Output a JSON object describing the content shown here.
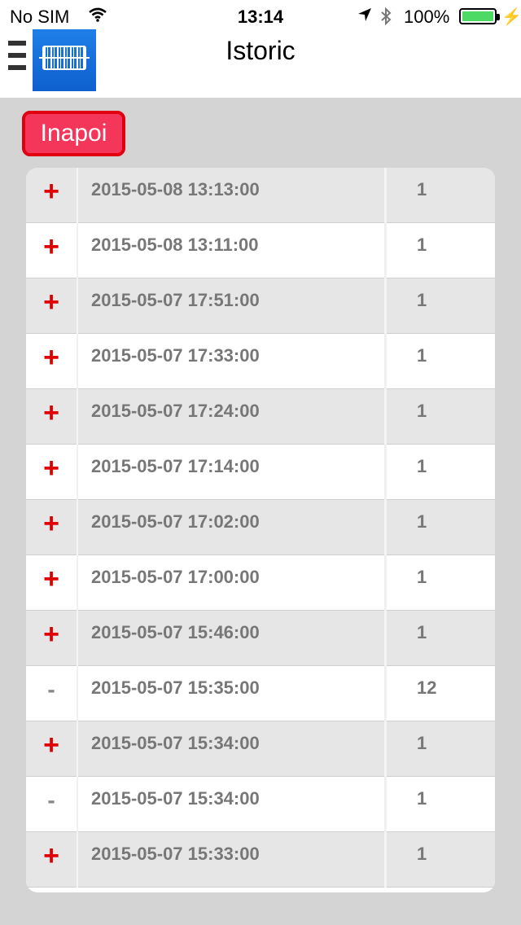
{
  "status_bar": {
    "carrier": "No SIM",
    "time": "13:14",
    "battery": "100%"
  },
  "header": {
    "title": "Istoric"
  },
  "back_button": {
    "label": "Inapoi"
  },
  "colors": {
    "plus": "#e00000",
    "back_button": "#f3365a",
    "accent": "#1f7fe8"
  },
  "history": [
    {
      "sign": "+",
      "date": "2015-05-08 13:13:00",
      "qty": "1"
    },
    {
      "sign": "+",
      "date": "2015-05-08 13:11:00",
      "qty": "1"
    },
    {
      "sign": "+",
      "date": "2015-05-07 17:51:00",
      "qty": "1"
    },
    {
      "sign": "+",
      "date": "2015-05-07 17:33:00",
      "qty": "1"
    },
    {
      "sign": "+",
      "date": "2015-05-07 17:24:00",
      "qty": "1"
    },
    {
      "sign": "+",
      "date": "2015-05-07 17:14:00",
      "qty": "1"
    },
    {
      "sign": "+",
      "date": "2015-05-07 17:02:00",
      "qty": "1"
    },
    {
      "sign": "+",
      "date": "2015-05-07 17:00:00",
      "qty": "1"
    },
    {
      "sign": "+",
      "date": "2015-05-07 15:46:00",
      "qty": "1"
    },
    {
      "sign": "-",
      "date": "2015-05-07 15:35:00",
      "qty": "12"
    },
    {
      "sign": "+",
      "date": "2015-05-07 15:34:00",
      "qty": "1"
    },
    {
      "sign": "-",
      "date": "2015-05-07 15:34:00",
      "qty": "1"
    },
    {
      "sign": "+",
      "date": "2015-05-07 15:33:00",
      "qty": "1"
    }
  ]
}
